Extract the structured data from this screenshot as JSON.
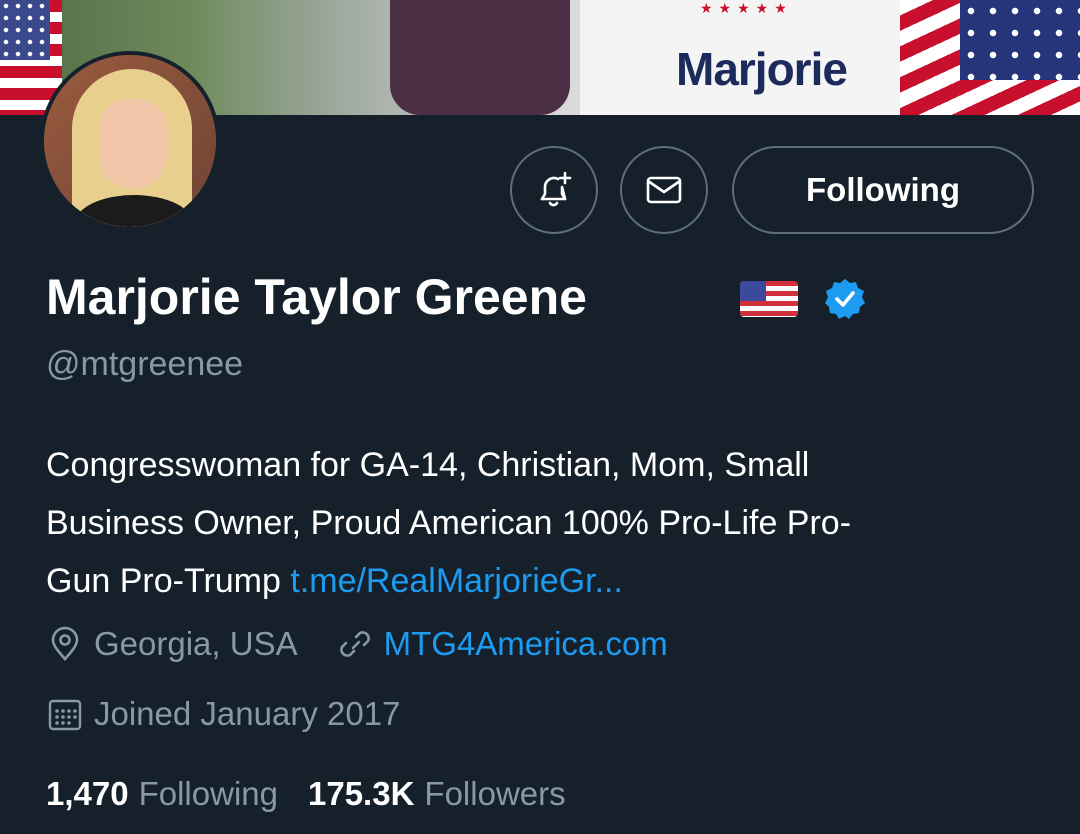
{
  "banner": {
    "sign_text": "Marjorie",
    "sign_stars": "★★★★★"
  },
  "profile": {
    "display_name": "Marjorie Taylor Greene",
    "flag_emoji": "🇺🇸",
    "verified": true,
    "handle": "@mtgreenee",
    "bio_lines": [
      "Congresswoman for GA-14, Christian, Mom, Small",
      "Business Owner, Proud American 100% Pro-Life Pro-",
      "Gun Pro-Trump "
    ],
    "bio_link": "t.me/RealMarjorieGr...",
    "location": "Georgia, USA",
    "website": "MTG4America.com",
    "joined": "Joined January 2017"
  },
  "actions": {
    "follow_label": "Following"
  },
  "stats": {
    "following_count": "1,470",
    "following_label": "Following",
    "followers_count": "175.3K",
    "followers_label": "Followers"
  },
  "colors": {
    "background": "#15202b",
    "muted_text": "#8899a6",
    "link": "#1d9bf0",
    "verified_badge": "#1d9bf0",
    "button_border": "#5e6e7b"
  },
  "icons": {
    "notify": "bell-plus-icon",
    "message": "envelope-icon",
    "location": "location-pin-icon",
    "website": "link-icon",
    "joined": "calendar-icon",
    "verified": "verified-badge-icon"
  }
}
